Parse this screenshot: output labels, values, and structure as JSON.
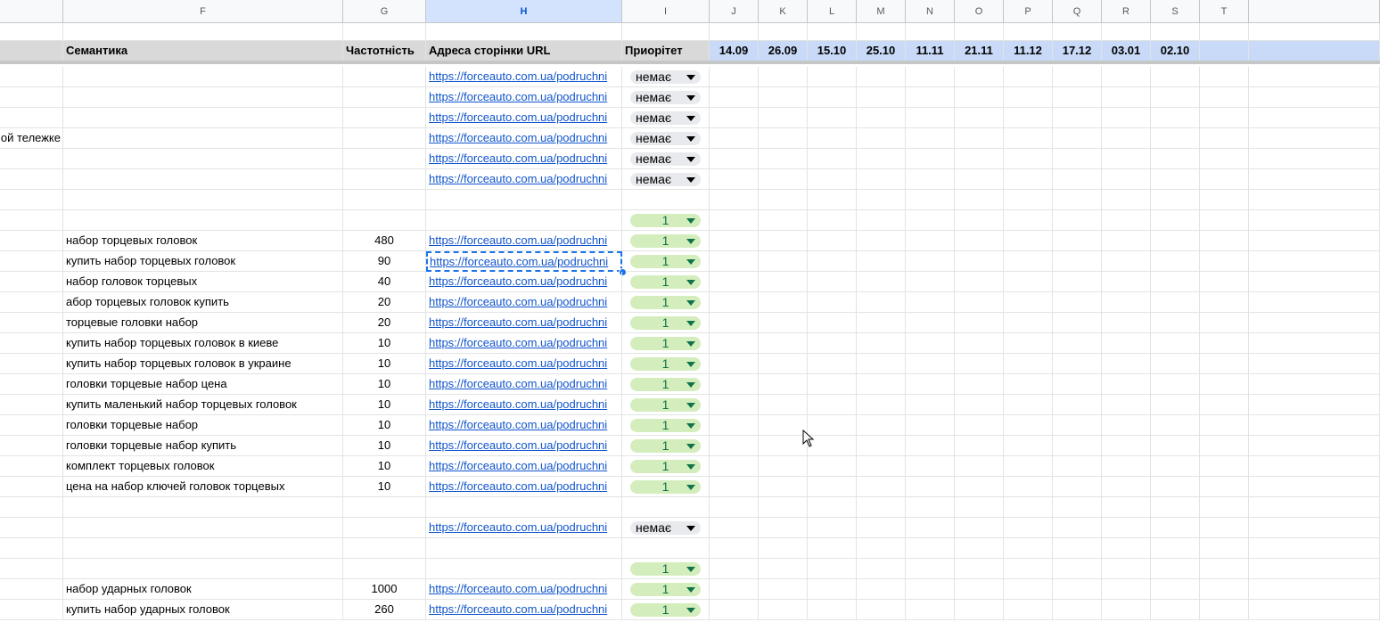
{
  "columns": [
    {
      "key": "E",
      "label": "",
      "w": 71
    },
    {
      "key": "F",
      "label": "F",
      "w": 314
    },
    {
      "key": "G",
      "label": "G",
      "w": 93
    },
    {
      "key": "H",
      "label": "H",
      "w": 220
    },
    {
      "key": "I",
      "label": "I",
      "w": 98
    },
    {
      "key": "J",
      "label": "J",
      "w": 55
    },
    {
      "key": "K",
      "label": "K",
      "w": 55
    },
    {
      "key": "L",
      "label": "L",
      "w": 55
    },
    {
      "key": "M",
      "label": "M",
      "w": 55
    },
    {
      "key": "N",
      "label": "N",
      "w": 55
    },
    {
      "key": "O",
      "label": "O",
      "w": 55
    },
    {
      "key": "P",
      "label": "P",
      "w": 55
    },
    {
      "key": "Q",
      "label": "Q",
      "w": 55
    },
    {
      "key": "R",
      "label": "R",
      "w": 55
    },
    {
      "key": "S",
      "label": "S",
      "w": 55
    },
    {
      "key": "T",
      "label": "T",
      "w": 55
    },
    {
      "key": "U",
      "label": "",
      "w": 147
    }
  ],
  "selected_column": "H",
  "header": {
    "semantics": "Семантика",
    "frequency": "Частотність",
    "url": "Адреса сторінки URL",
    "priority": "Приорітет",
    "dates": [
      "14.09",
      "26.09",
      "15.10",
      "25.10",
      "11.11",
      "21.11",
      "11.12",
      "17.12",
      "03.01",
      "02.10"
    ]
  },
  "url_text": "https://forceauto.com.ua/podruchni",
  "rows": [
    {
      "e": "",
      "f": "",
      "g": "",
      "url": true,
      "p": "немає"
    },
    {
      "e": "",
      "f": "",
      "g": "",
      "url": true,
      "p": "немає"
    },
    {
      "e": "",
      "f": "",
      "g": "",
      "url": true,
      "p": "немає"
    },
    {
      "e": "ой тележке",
      "f": "",
      "g": "",
      "url": true,
      "p": "немає"
    },
    {
      "e": "",
      "f": "",
      "g": "",
      "url": true,
      "p": "немає"
    },
    {
      "e": "",
      "f": "",
      "g": "",
      "url": true,
      "p": "немає"
    },
    {
      "e": "",
      "f": "",
      "g": "",
      "url": false,
      "p": ""
    },
    {
      "e": "",
      "f": "",
      "g": "",
      "url": false,
      "p": "1"
    },
    {
      "e": "",
      "f": "набор торцевых головок",
      "g": "480",
      "url": true,
      "p": "1"
    },
    {
      "e": "",
      "f": "купить набор торцевых головок",
      "g": "90",
      "url": true,
      "p": "1",
      "selected": true
    },
    {
      "e": "",
      "f": "набор головок торцевых",
      "g": "40",
      "url": true,
      "p": "1"
    },
    {
      "e": "",
      "f": "абор торцевых головок купить",
      "g": "20",
      "url": true,
      "p": "1"
    },
    {
      "e": "",
      "f": "торцевые головки набор",
      "g": "20",
      "url": true,
      "p": "1"
    },
    {
      "e": "",
      "f": "купить набор торцевых головок в киеве",
      "g": "10",
      "url": true,
      "p": "1"
    },
    {
      "e": "",
      "f": "купить набор торцевых головок в украине",
      "g": "10",
      "url": true,
      "p": "1"
    },
    {
      "e": "",
      "f": "головки торцевые набор цена",
      "g": "10",
      "url": true,
      "p": "1"
    },
    {
      "e": "",
      "f": "купить маленький набор торцевых головок",
      "g": "10",
      "url": true,
      "p": "1"
    },
    {
      "e": "",
      "f": "головки торцевые набор",
      "g": "10",
      "url": true,
      "p": "1"
    },
    {
      "e": "",
      "f": "головки торцевые набор купить",
      "g": "10",
      "url": true,
      "p": "1"
    },
    {
      "e": "",
      "f": "комплект торцевых головок",
      "g": "10",
      "url": true,
      "p": "1"
    },
    {
      "e": "",
      "f": "цена на набор ключей головок торцевых",
      "g": "10",
      "url": true,
      "p": "1"
    },
    {
      "e": "",
      "f": "",
      "g": "",
      "url": false,
      "p": ""
    },
    {
      "e": "",
      "f": "",
      "g": "",
      "url": true,
      "p": "немає"
    },
    {
      "e": "",
      "f": "",
      "g": "",
      "url": false,
      "p": ""
    },
    {
      "e": "",
      "f": "",
      "g": "",
      "url": false,
      "p": "1"
    },
    {
      "e": "",
      "f": "набор ударных головок",
      "g": "1000",
      "url": true,
      "p": "1"
    },
    {
      "e": "",
      "f": "купить набор ударных головок",
      "g": "260",
      "url": true,
      "p": "1"
    }
  ]
}
